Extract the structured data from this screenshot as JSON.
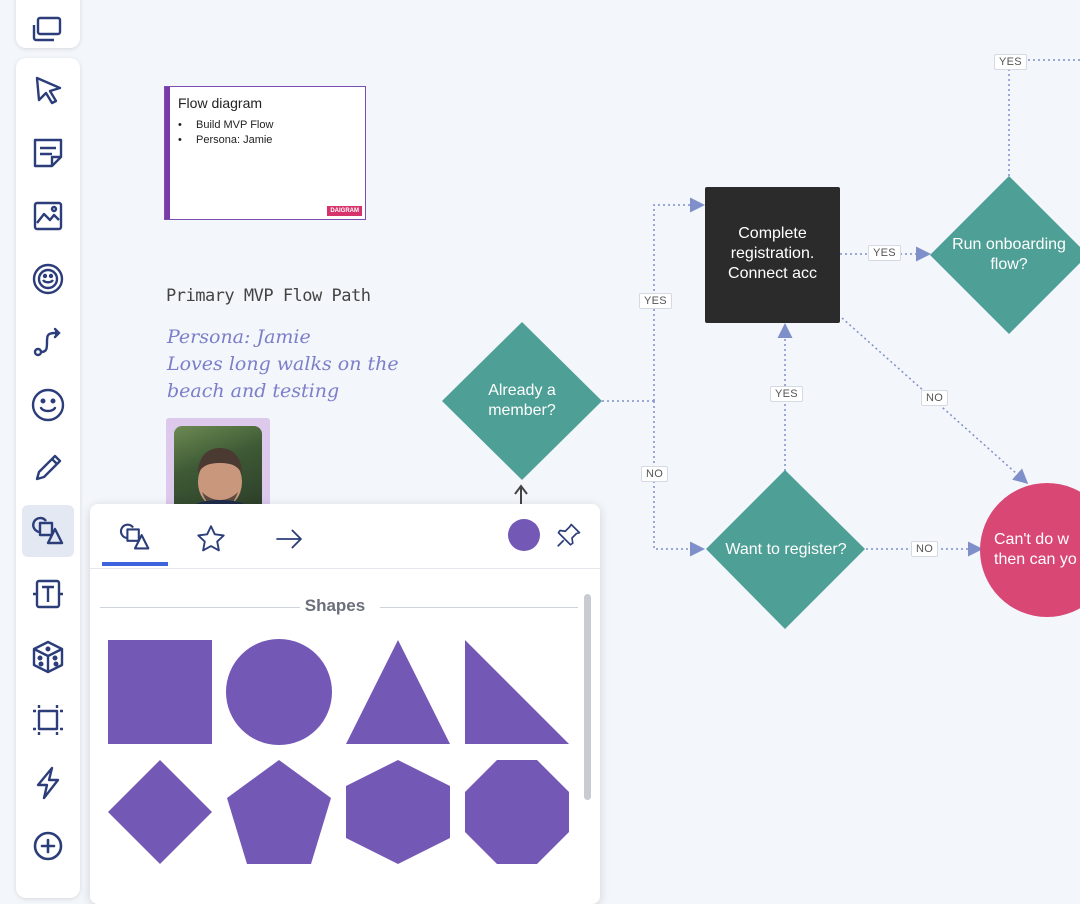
{
  "toolbar": {
    "top_item": "windows-icon",
    "items": [
      "cursor-icon",
      "sticky-note-icon",
      "image-icon",
      "sticker-icon",
      "connector-icon",
      "emoji-icon",
      "pen-icon",
      "shapes-icon",
      "text-icon",
      "dice-icon",
      "frame-icon",
      "lightning-icon",
      "add-icon"
    ],
    "active": "shapes-icon"
  },
  "slide": {
    "title": "Flow diagram",
    "bullets": [
      "Build MVP Flow",
      "Persona: Jamie"
    ],
    "logo": "DAIGRAM"
  },
  "notes": {
    "heading": "Primary MVP Flow Path",
    "persona_lines": [
      "Persona: Jamie",
      "Loves long walks on the",
      "beach and testing"
    ]
  },
  "flow": {
    "nodes": {
      "already_member": "Already a member?",
      "complete_registration": [
        "Complete",
        "registration.",
        "Connect acc"
      ],
      "run_onboarding": [
        "Run onboarding",
        "flow?"
      ],
      "want_register": "Want to register?",
      "cant_do": [
        "Can't do w",
        "then can yo"
      ]
    },
    "labels": {
      "yes_top": "YES",
      "yes_left": "YES",
      "yes_mid": "YES",
      "yes_vertical": "YES",
      "no_left": "NO",
      "no_diag": "NO",
      "no_bottom": "NO"
    },
    "colors": {
      "teal": "#4e9f95",
      "dark": "#2b2b2b",
      "pink": "#d94775",
      "edge": "#7f8fca"
    }
  },
  "panel": {
    "tabs": [
      "shapes-tab-icon",
      "star-icon",
      "arrow-right-icon"
    ],
    "active_tab": "shapes-tab-icon",
    "color": "#7358b5",
    "section_title": "Shapes",
    "shapes": [
      "square",
      "circle",
      "triangle",
      "right-triangle",
      "diamond",
      "pentagon",
      "hexagon",
      "octagon"
    ]
  }
}
